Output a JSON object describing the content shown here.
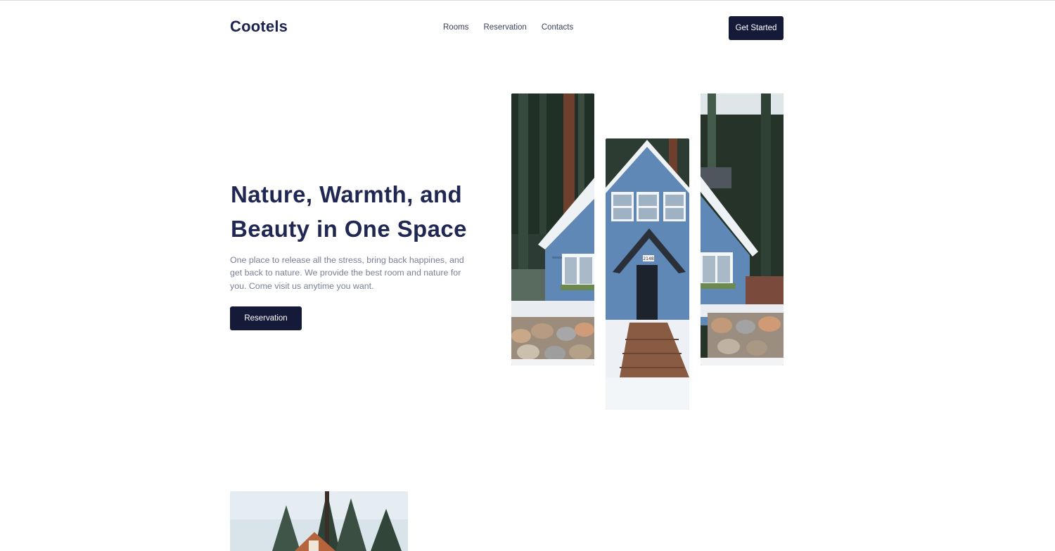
{
  "header": {
    "logo": "Cootels",
    "nav": [
      "Rooms",
      "Reservation",
      "Contacts"
    ],
    "cta_label": "Get Started"
  },
  "hero": {
    "title_line1": "Nature, Warmth, and",
    "title_line2": "Beauty in One Space",
    "description": "One place to release all the stress, bring back happines, and get back to nature. We provide the best room and nature for you. Come visit us anytime you want.",
    "button_label": "Reservation",
    "house_number": "2148"
  },
  "colors": {
    "primary_dark": "#141a38",
    "title": "#1f2752",
    "body_text": "#7a7f96",
    "house_blue": "#5f88b6"
  }
}
